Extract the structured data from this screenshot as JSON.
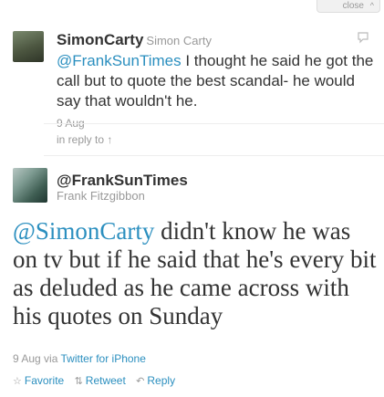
{
  "header": {
    "close_label": "close",
    "close_icon": "chevron-up"
  },
  "reply_tweet": {
    "name": "SimonCarty",
    "handle": "Simon Carty",
    "mention": "@FrankSunTimes",
    "text": " I thought he said he got the call but to quote the best scandal- he would say that wouldn't he.",
    "date": "9 Aug",
    "icon": "comment-icon"
  },
  "in_reply_to": {
    "label": "in reply to",
    "icon": "up-arrow"
  },
  "main_tweet": {
    "name": "@FrankSunTimes",
    "handle": "Frank Fitzgibbon",
    "mention": "@SimonCarty",
    "text": " didn't know he was on tv but if he said that he's every bit as deluded as he came across with his quotes on Sunday",
    "date": "9 Aug",
    "via_label": "via",
    "source": "Twitter for iPhone"
  },
  "actions": {
    "favorite": "Favorite",
    "retweet": "Retweet",
    "reply": "Reply"
  },
  "colors": {
    "link": "#2b8fbf",
    "muted": "#999999",
    "text": "#333333"
  }
}
